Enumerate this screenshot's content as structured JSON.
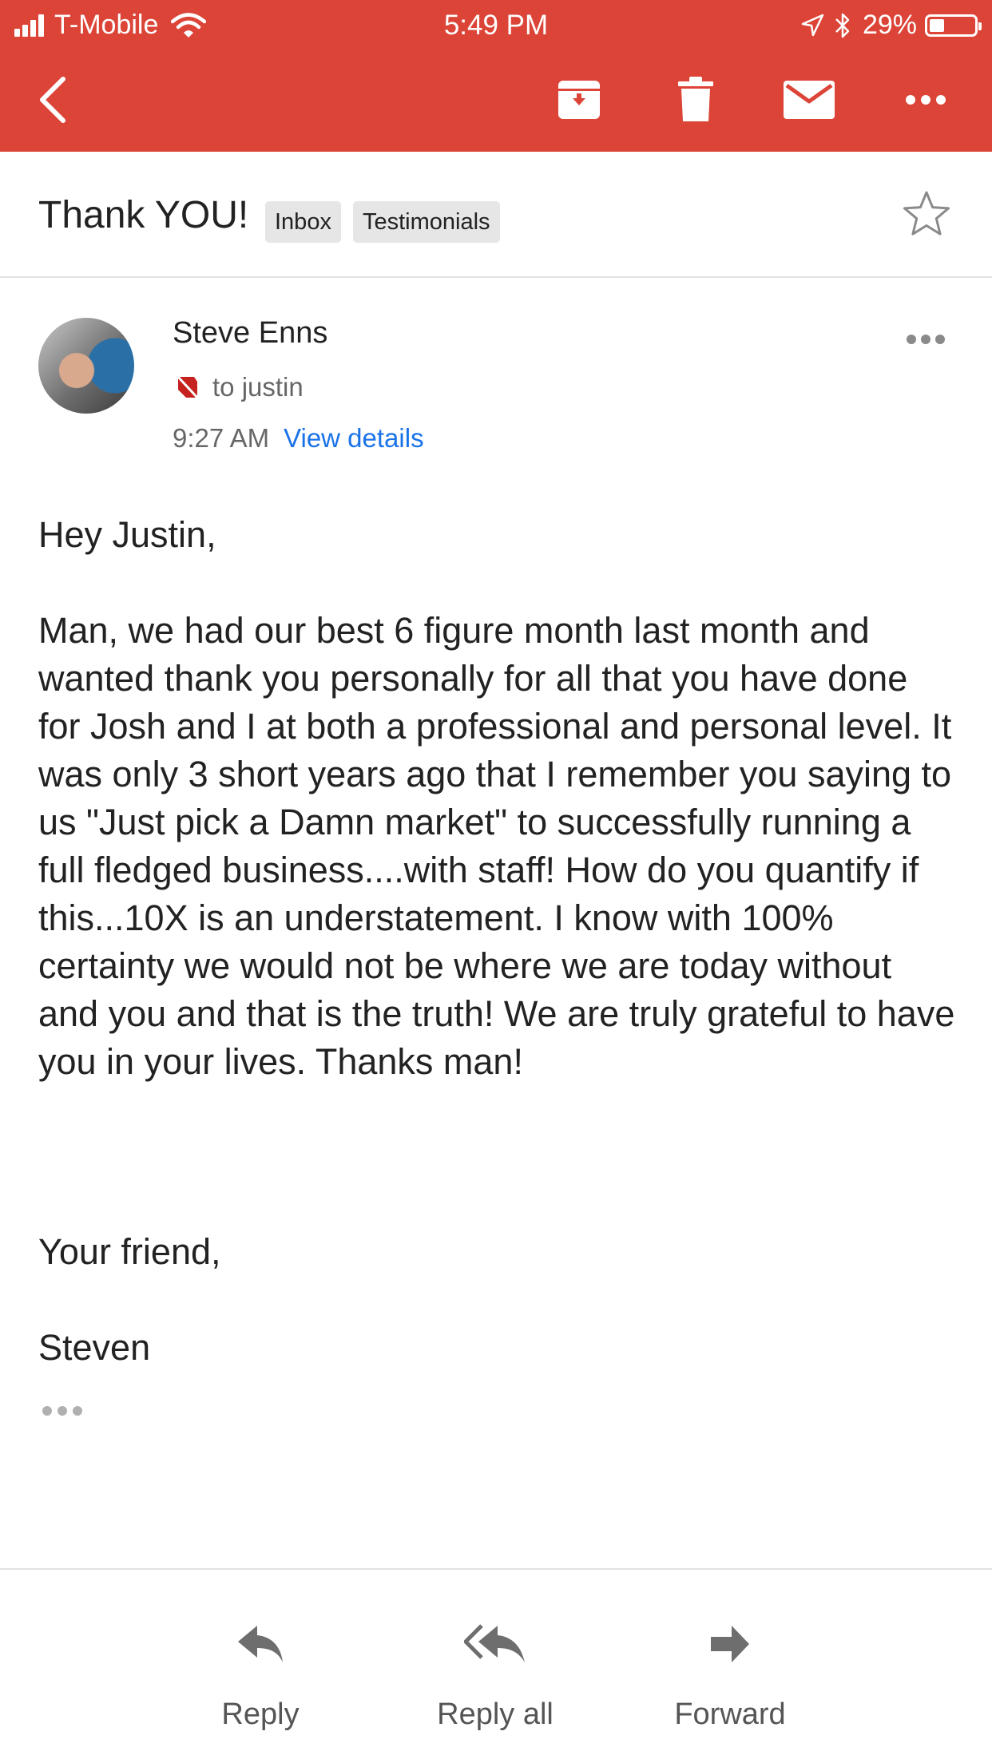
{
  "status_bar": {
    "carrier": "T-Mobile",
    "time": "5:49 PM",
    "battery_percent": "29%",
    "battery_level": 0.29
  },
  "toolbar": {
    "back_icon": "chevron-left-icon",
    "archive_icon": "archive-icon",
    "delete_icon": "trash-icon",
    "mark_unread_icon": "mail-icon",
    "more_icon": "more-horizontal-icon"
  },
  "email": {
    "subject": "Thank YOU!",
    "labels": [
      "Inbox",
      "Testimonials"
    ],
    "sender": "Steve Enns",
    "recipient": "to justin",
    "time": "9:27 AM",
    "view_details": "View details",
    "body": {
      "greeting": "Hey Justin,",
      "paragraph": "Man, we had our best 6 figure month last month and wanted thank you personally for all that you have done for Josh and I at both a professional and personal level.  It was only 3 short years ago that I remember you saying to us \"Just pick a Damn market\" to successfully running a full fledged business....with staff!  How do you quantify if this...10X is an understatement.  I know with 100% certainty we would not be where we are today without and you and that is the truth!  We are truly grateful to have you in your lives. Thanks man!",
      "closing": "Your friend,",
      "signature": "Steven"
    }
  },
  "actions": {
    "reply": "Reply",
    "reply_all": "Reply all",
    "forward": "Forward"
  },
  "colors": {
    "appbar": "#db4437",
    "link": "#1a73e8",
    "important_marker": "#c5221f"
  }
}
